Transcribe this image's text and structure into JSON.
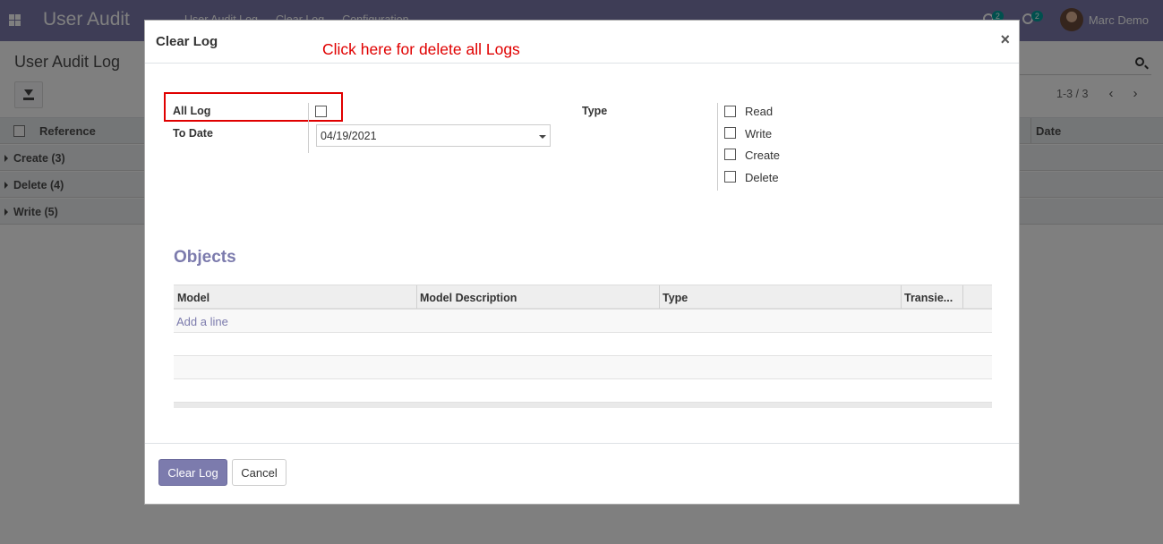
{
  "navbar": {
    "app_name": "User Audit",
    "menu": [
      "User Audit Log",
      "Clear Log",
      "Configuration"
    ],
    "messages_count": "2",
    "activities_count": "2",
    "user_name": "Marc Demo"
  },
  "control_panel": {
    "title": "User Audit Log",
    "pager": "1-3 / 3"
  },
  "list": {
    "columns": {
      "reference": "Reference",
      "date": "Date"
    },
    "groups": [
      "Create (3)",
      "Delete (4)",
      "Write (5)"
    ]
  },
  "modal": {
    "title": "Clear Log",
    "annotation": "Click here for delete all Logs",
    "close": "×",
    "all_log_label": "All Log",
    "all_log_checked": false,
    "to_date_label": "To Date",
    "to_date_value": "04/19/2021",
    "type_label": "Type",
    "type_options": [
      "Read",
      "Write",
      "Create",
      "Delete"
    ],
    "objects_title": "Objects",
    "objects_columns": [
      "Model",
      "Model Description",
      "Type",
      "Transie..."
    ],
    "add_line": "Add a line",
    "clear_button": "Clear Log",
    "cancel_button": "Cancel"
  }
}
